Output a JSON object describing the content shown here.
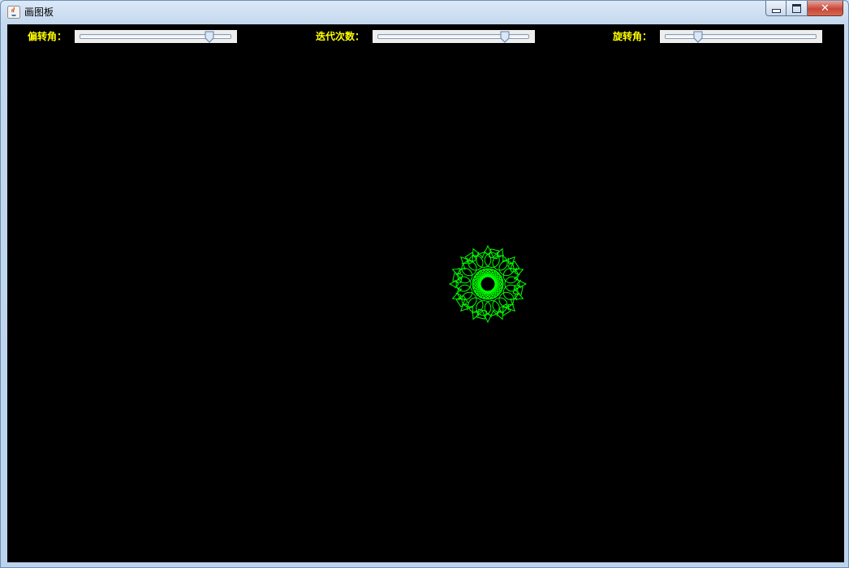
{
  "window": {
    "title": "画图板"
  },
  "controls": [
    {
      "label": "偏转角：",
      "value_fraction": 0.88
    },
    {
      "label": "迭代次数：",
      "value_fraction": 0.86
    },
    {
      "label": "旋转角：",
      "value_fraction": 0.2
    }
  ],
  "colors": {
    "canvas_background": "#000000",
    "label_color": "#ffff00",
    "drawing_color": "#00ff00"
  },
  "icons": [
    "java-app-icon",
    "minimize-icon",
    "maximize-icon",
    "close-icon"
  ]
}
